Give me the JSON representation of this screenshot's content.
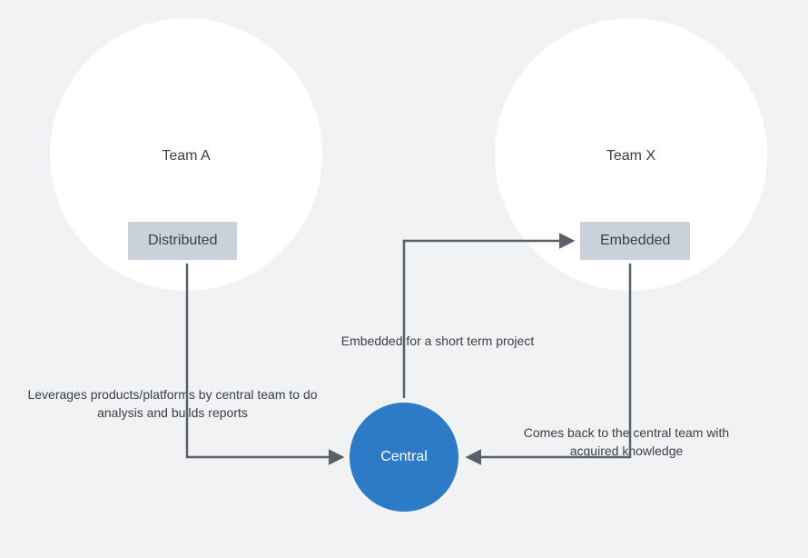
{
  "teamA": {
    "label": "Team A",
    "badge": "Distributed"
  },
  "teamX": {
    "label": "Team X",
    "badge": "Embedded"
  },
  "central": {
    "label": "Central"
  },
  "annotations": {
    "embeddedShort": "Embedded for a short term project",
    "leverages": "Leverages products/platforms by central team to do analysis and builds reports",
    "comesBack": "Comes back to the central team with acquired knowledge"
  },
  "colors": {
    "background": "#f0f2f4",
    "circleFill": "#ffffff",
    "badgeFill": "#c9d2da",
    "centralFill": "#2d7bc7",
    "text": "#3b4046",
    "arrow": "#5a6069"
  }
}
